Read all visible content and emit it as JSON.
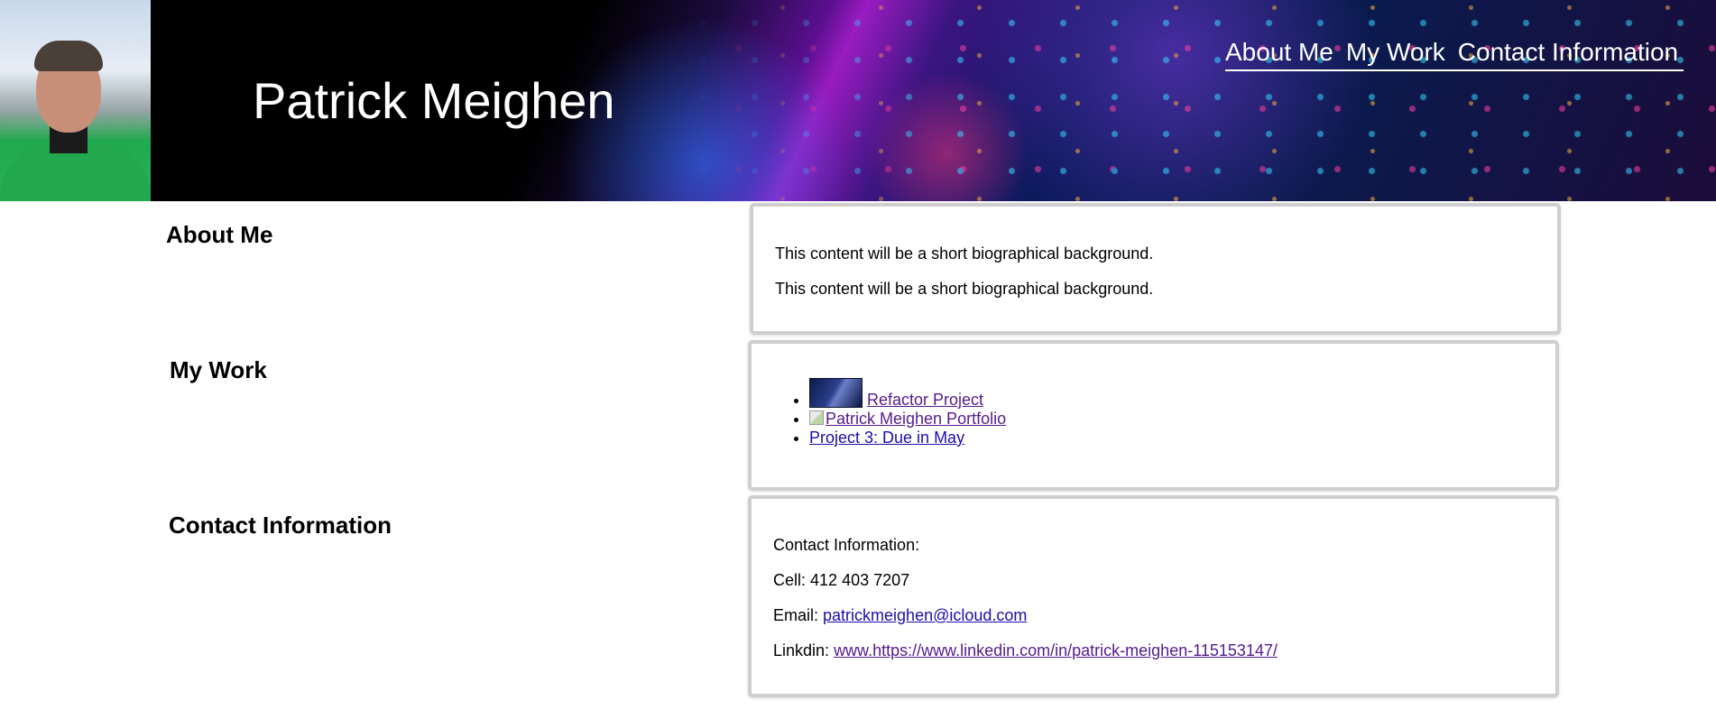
{
  "header": {
    "site_title": "Patrick Meighen",
    "nav": [
      {
        "label": "About Me"
      },
      {
        "label": "My Work"
      },
      {
        "label": "Contact Information"
      }
    ]
  },
  "about": {
    "heading": "About Me",
    "paragraphs": [
      "This content will be a short biographical background.",
      "This content will be a short biographical background."
    ]
  },
  "work": {
    "heading": "My Work",
    "items": [
      {
        "label": "Refactor Project",
        "icon": "project-thumbnail"
      },
      {
        "label": "Patrick Meighen Portfolio",
        "icon": "broken-image-icon"
      },
      {
        "label": "Project 3: Due in May"
      }
    ]
  },
  "contact": {
    "heading": "Contact Information",
    "intro": "Contact Information:",
    "cell_label": "Cell:",
    "cell_value": "412 403 7207",
    "email_label": "Email:",
    "email_value": "patrickmeighen@icloud.com",
    "linkedin_label": "Linkdin:",
    "linkedin_value": "www.https://www.linkedin.com/in/patrick-meighen-115153147/"
  },
  "colors": {
    "link": "#1a0dab",
    "visited_link": "#551a8b",
    "card_border": "#cfcfcf"
  }
}
